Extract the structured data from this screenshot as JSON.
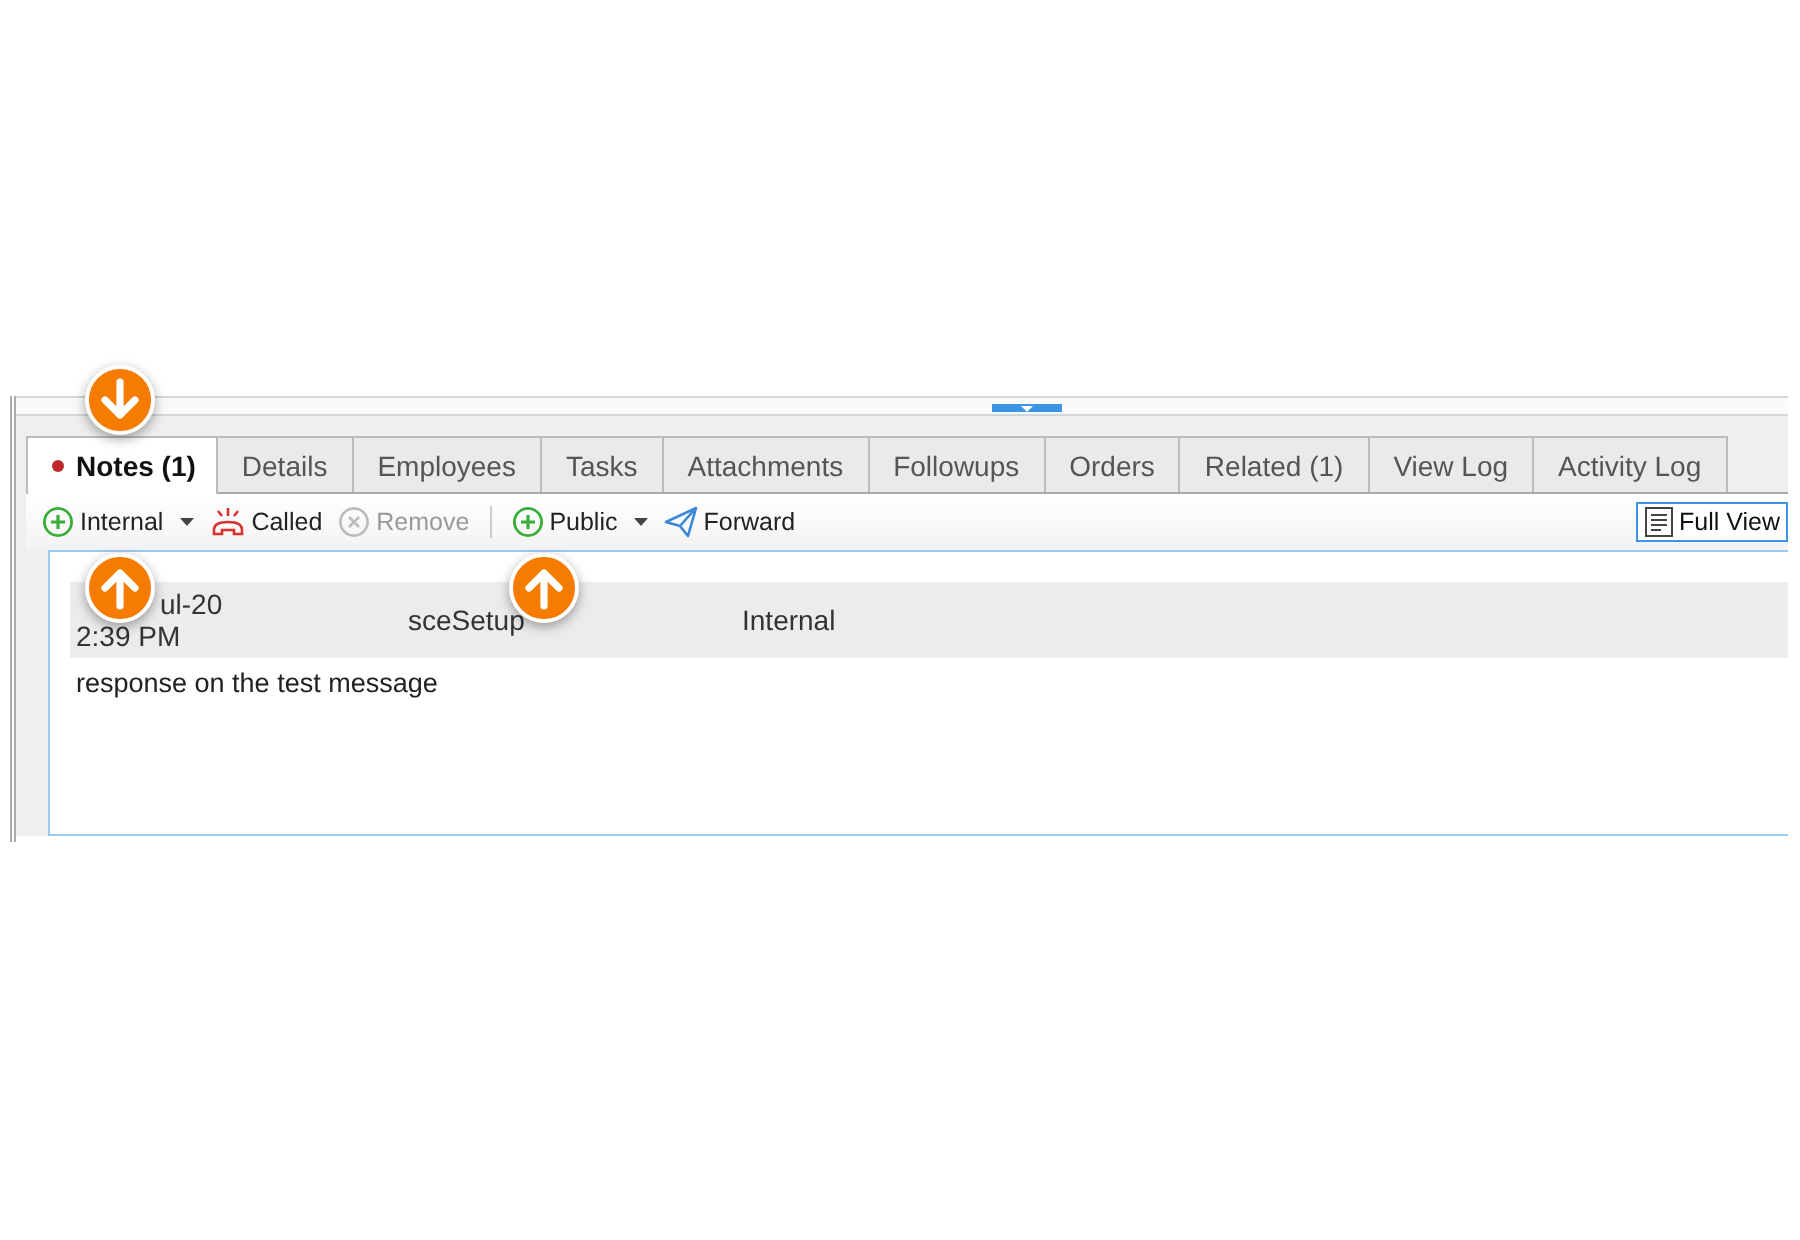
{
  "tabs": [
    {
      "label": "Notes (1)",
      "selected": true,
      "flagged": true
    },
    {
      "label": "Details",
      "selected": false,
      "flagged": false
    },
    {
      "label": "Employees",
      "selected": false,
      "flagged": false
    },
    {
      "label": "Tasks",
      "selected": false,
      "flagged": false
    },
    {
      "label": "Attachments",
      "selected": false,
      "flagged": false
    },
    {
      "label": "Followups",
      "selected": false,
      "flagged": false
    },
    {
      "label": "Orders",
      "selected": false,
      "flagged": false
    },
    {
      "label": "Related (1)",
      "selected": false,
      "flagged": false
    },
    {
      "label": "View Log",
      "selected": false,
      "flagged": false
    },
    {
      "label": "Activity Log",
      "selected": false,
      "flagged": false
    }
  ],
  "toolbar": {
    "items": [
      {
        "kind": "add",
        "label": "Internal",
        "dropdown": true,
        "disabled": false
      },
      {
        "kind": "called",
        "label": "Called",
        "dropdown": false,
        "disabled": false
      },
      {
        "kind": "remove",
        "label": "Remove",
        "dropdown": false,
        "disabled": true
      },
      {
        "kind": "separator"
      },
      {
        "kind": "add",
        "label": "Public",
        "dropdown": true,
        "disabled": false
      },
      {
        "kind": "forward",
        "label": "Forward",
        "dropdown": false,
        "disabled": false
      }
    ],
    "full_view": {
      "label": "Full View"
    }
  },
  "notes": [
    {
      "date_parts": [
        "ul-20"
      ],
      "time": "2:39 PM",
      "author": "sceSetup",
      "visibility": "Internal",
      "text": "response on the test message"
    }
  ],
  "markers": [
    {
      "kind": "down"
    },
    {
      "kind": "up"
    },
    {
      "kind": "up"
    }
  ]
}
